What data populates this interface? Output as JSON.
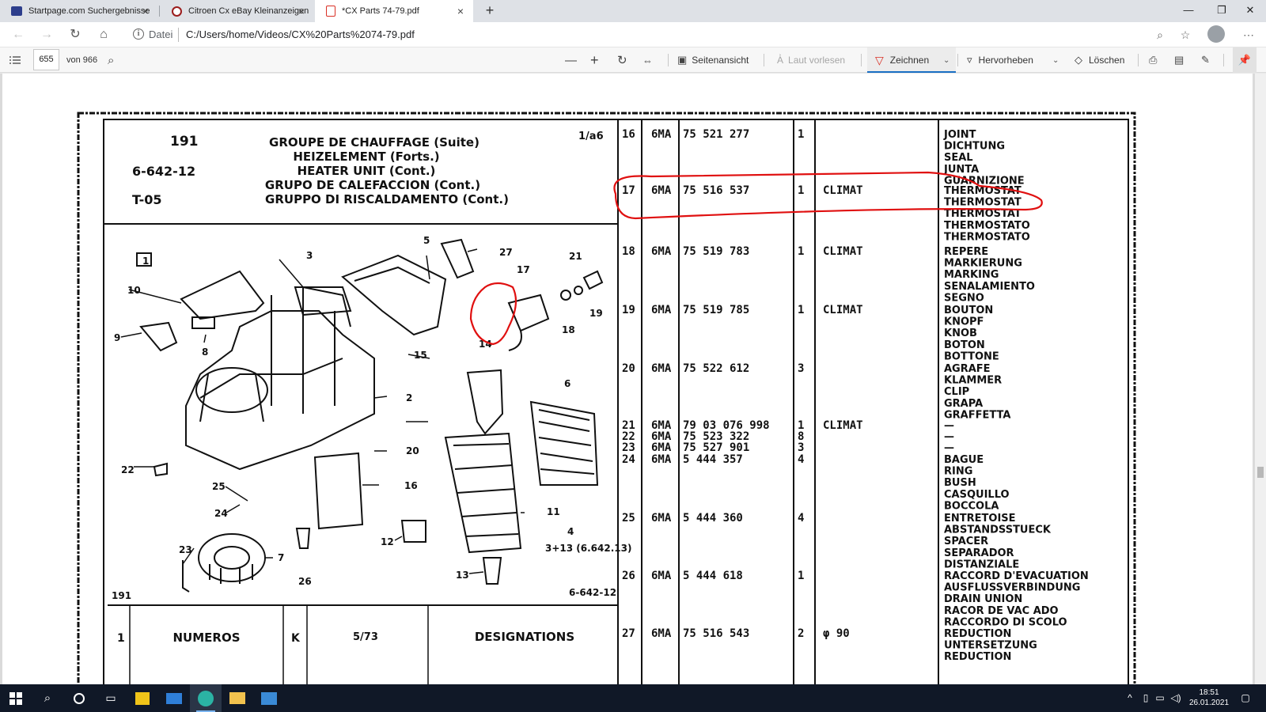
{
  "tabs": [
    {
      "title": "Startpage.com Suchergebnisse",
      "favicon_color": "#2d3e8c"
    },
    {
      "title": "Citroen Cx eBay Kleinanzeigen",
      "favicon_color": "#9b1c1c"
    },
    {
      "title": "*CX Parts 74-79.pdf",
      "favicon_color": "#d93025"
    }
  ],
  "address": {
    "scheme_label": "Datei",
    "url": "C:/Users/home/Videos/CX%20Parts%2074-79.pdf"
  },
  "pdf_toolbar": {
    "current_page": "655",
    "total_pages": "von 966",
    "page_view": "Seitenansicht",
    "read_aloud": "Laut vorlesen",
    "draw": "Zeichnen",
    "highlight": "Hervorheben",
    "erase": "Löschen"
  },
  "doc_header": {
    "number": "191",
    "code": "6-642-12",
    "sheet": "T-05",
    "page_ref": "1/a6",
    "titles": [
      "GROUPE DE CHAUFFAGE (Suite)",
      "HEIZELEMENT (Forts.)",
      "HEATER UNIT (Cont.)",
      "GRUPO DE CALEFACCION (Cont.)",
      "GRUPPO DI RISCALDAMENTO (Cont.)"
    ]
  },
  "diagram": {
    "box_label": "1",
    "bottom_left": "191",
    "bottom_right": "6-642-12",
    "ref_note": "3+13 (6.642.13)",
    "callouts": [
      "3",
      "5",
      "27",
      "17",
      "21",
      "10",
      "9",
      "8",
      "2",
      "15",
      "14",
      "18",
      "19",
      "6",
      "22",
      "20",
      "16",
      "11",
      "25",
      "24",
      "12",
      "4",
      "23",
      "7",
      "26",
      "13",
      "1"
    ]
  },
  "footer": {
    "col1": "1",
    "numeros": "NUMEROS",
    "k": "K",
    "page": "5/73",
    "designations": "DESIGNATIONS"
  },
  "parts": [
    {
      "ref": "16",
      "pre": "6MA",
      "num": "75 521 277",
      "qty": "1",
      "note": "",
      "names": [
        "JOINT",
        "DICHTUNG",
        "SEAL",
        "JUNTA",
        "GUARNIZIONE"
      ]
    },
    {
      "ref": "17",
      "pre": "6MA",
      "num": "75 516 537",
      "qty": "1",
      "note": "CLIMAT",
      "names": [
        "THERMOSTAT",
        "THERMOSTAT",
        "THERMOSTAT",
        "THERMOSTATO",
        "THERMOSTATO"
      ]
    },
    {
      "ref": "18",
      "pre": "6MA",
      "num": "75 519 783",
      "qty": "1",
      "note": "CLIMAT",
      "names": [
        "REPERE",
        "MARKIERUNG",
        "MARKING",
        "SENALAMIENTO",
        "SEGNO"
      ]
    },
    {
      "ref": "19",
      "pre": "6MA",
      "num": "75 519 785",
      "qty": "1",
      "note": "CLIMAT",
      "names": [
        "BOUTON",
        "KNOPF",
        "KNOB",
        "BOTON",
        "BOTTONE"
      ]
    },
    {
      "ref": "20",
      "pre": "6MA",
      "num": "75 522 612",
      "qty": "3",
      "note": "",
      "names": [
        "AGRAFE",
        "KLAMMER",
        "CLIP",
        "GRAPA",
        "GRAFFETTA"
      ]
    },
    {
      "ref": "21",
      "pre": "6MA",
      "num": "79 03 076 998",
      "qty": "1",
      "note": "CLIMAT",
      "names": [
        "—"
      ]
    },
    {
      "ref": "22",
      "pre": "6MA",
      "num": "75 523 322",
      "qty": "8",
      "note": "",
      "names": [
        "—"
      ]
    },
    {
      "ref": "23",
      "pre": "6MA",
      "num": "75 527 901",
      "qty": "3",
      "note": "",
      "names": [
        "—"
      ]
    },
    {
      "ref": "24",
      "pre": "6MA",
      "num": "5 444 357",
      "qty": "4",
      "note": "",
      "names": [
        "BAGUE",
        "RING",
        "BUSH",
        "CASQUILLO",
        "BOCCOLA"
      ]
    },
    {
      "ref": "25",
      "pre": "6MA",
      "num": "5 444 360",
      "qty": "4",
      "note": "",
      "names": [
        "ENTRETOISE",
        "ABSTANDSSTUECK",
        "SPACER",
        "SEPARADOR",
        "DISTANZIALE"
      ]
    },
    {
      "ref": "26",
      "pre": "6MA",
      "num": "5 444 618",
      "qty": "1",
      "note": "",
      "names": [
        "RACCORD D'EVACUATION",
        "AUSFLUSSVERBINDUNG",
        "DRAIN UNION",
        "RACOR DE VAC ADO",
        "RACCORDO DI SCOLO"
      ]
    },
    {
      "ref": "27",
      "pre": "6MA",
      "num": "75 516 543",
      "qty": "2",
      "note": "φ 90",
      "names": [
        "REDUCTION",
        "UNTERSETZUNG",
        "REDUCTION"
      ]
    }
  ],
  "clock": {
    "time": "18:51",
    "date": "26.01.2021"
  },
  "colors": {
    "accent": "#1a6fc4",
    "annotation_red": "#e01010",
    "taskbar": "#101827"
  },
  "icons": [
    "list-icon",
    "search-icon",
    "zoom-out-icon",
    "zoom-in-icon",
    "rotate-icon",
    "fit-width-icon",
    "page-view-icon",
    "read-aloud-icon",
    "draw-icon",
    "highlight-icon",
    "eraser-icon",
    "print-icon",
    "save-icon",
    "save-as-icon",
    "pin-icon",
    "windows-start-icon",
    "taskbar-search-icon",
    "cortana-icon",
    "task-view-icon",
    "store-icon",
    "mail-icon",
    "edge-icon",
    "explorer-icon",
    "photos-icon"
  ]
}
